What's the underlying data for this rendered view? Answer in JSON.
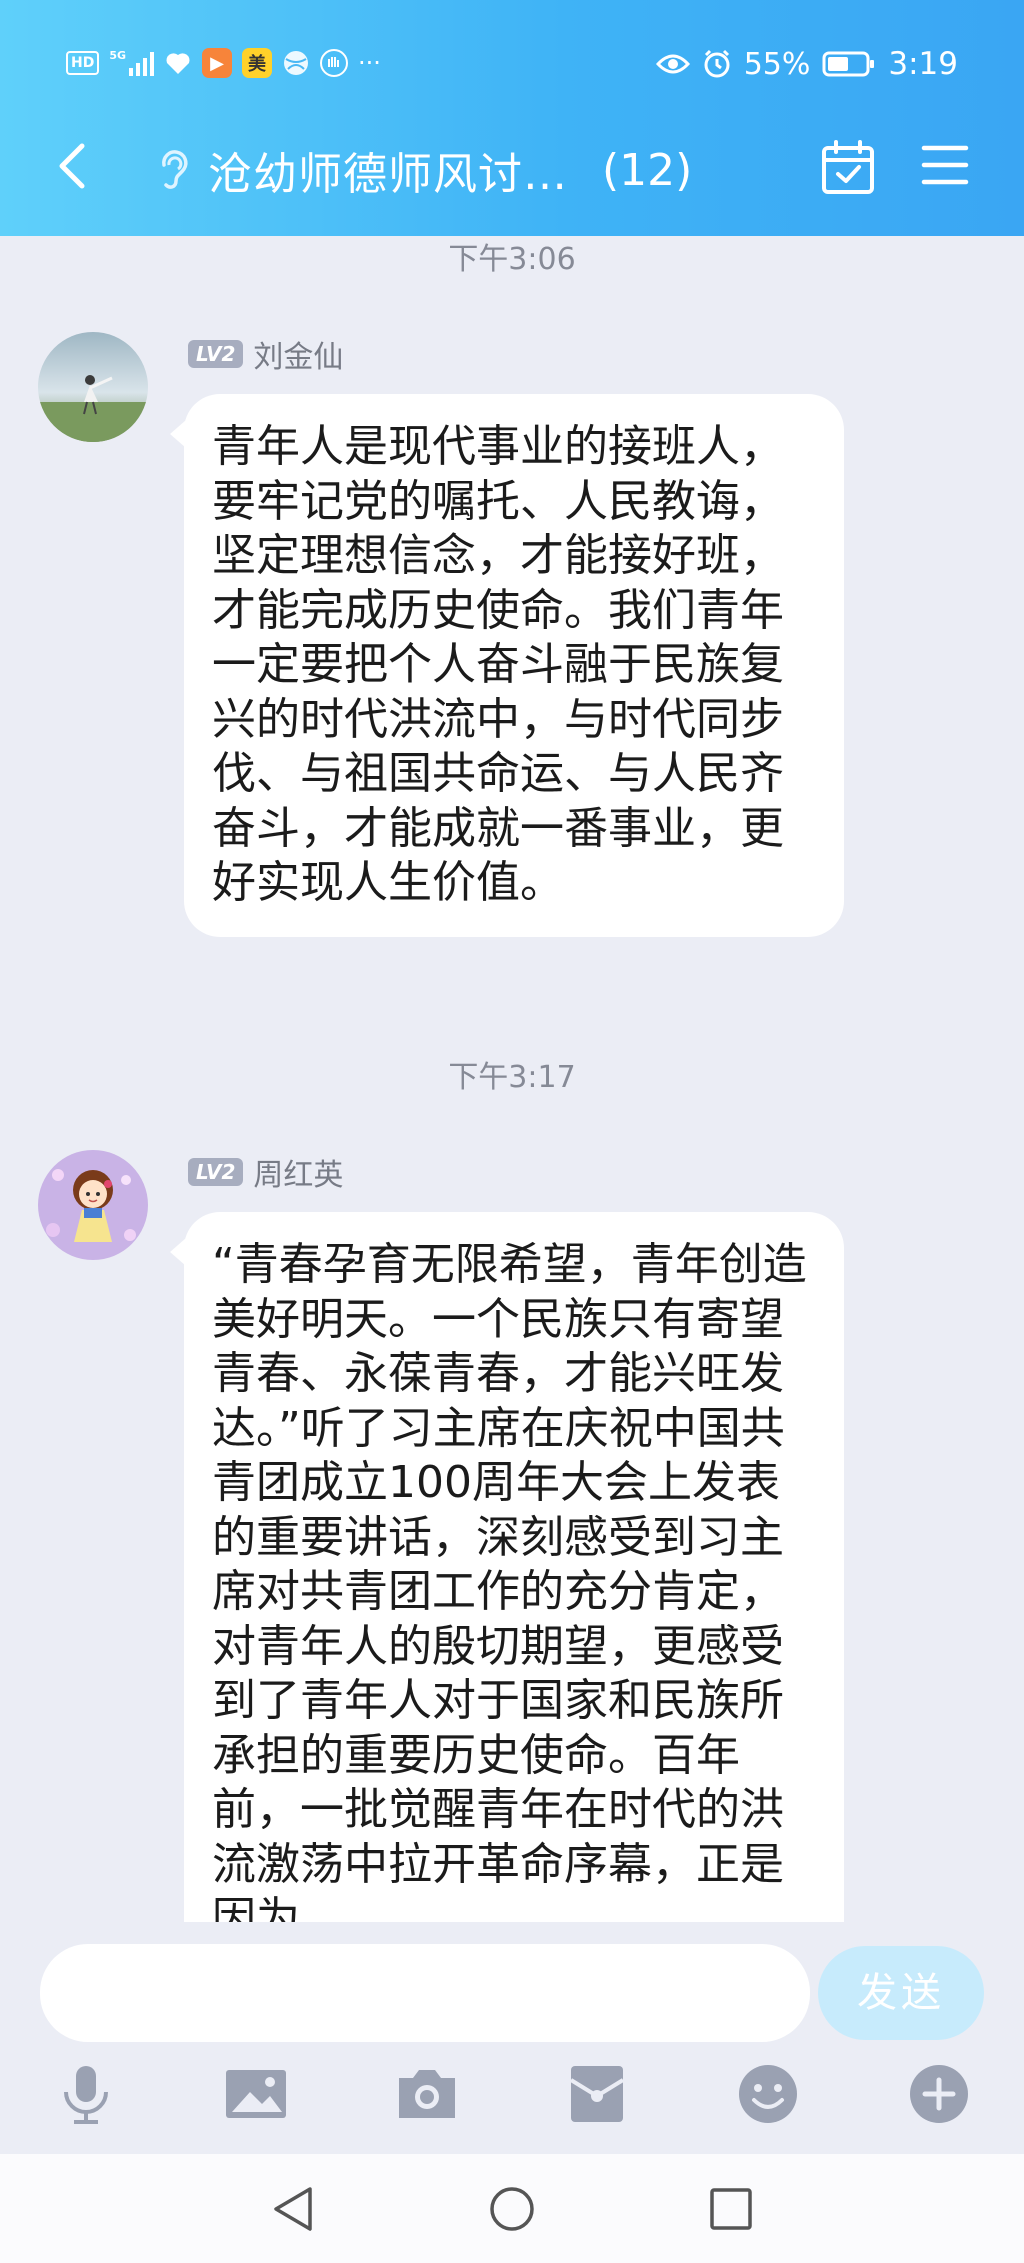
{
  "status_bar": {
    "left_badge": "HD",
    "network": "5G",
    "app_badge_mei": "美",
    "more_dots": "···",
    "battery": "55%",
    "time": "3:19"
  },
  "header": {
    "title": "沧幼师德师风讨…",
    "member_count": "(12)",
    "icons": [
      "back-arrow-icon",
      "ear-icon",
      "calendar-check-icon",
      "menu-icon"
    ]
  },
  "messages": [
    {
      "timestamp": "下午3:06",
      "level": "LV2",
      "sender": "刘金仙",
      "text": "青年人是现代事业的接班人，要牢记党的嘱托、人民教诲，坚定理想信念，才能接好班，才能完成历史使命。我们青年一定要把个人奋斗融于民族复兴的时代洪流中，与时代同步伐、与祖国共命运、与人民齐奋斗，才能成就一番事业，更好实现人生价值。"
    },
    {
      "timestamp": "下午3:17",
      "level": "LV2",
      "sender": "周红英",
      "text": "“青春孕育无限希望，青年创造美好明天。一个民族只有寄望青春、永葆青春，才能兴旺发达。”听了习主席在庆祝中国共青团成立100周年大会上发表的重要讲话，深刻感受到习主席对共青团工作的充分肯定，对青年人的殷切期望，更感受到了青年人对于国家和民族所承担的重要历史使命。百年前，一批觉醒青年在时代的洪流激荡中拉开革命序幕，正是因为"
    }
  ],
  "input_bar": {
    "send_label": "发送",
    "tools": [
      "microphone-icon",
      "image-icon",
      "camera-icon",
      "red-packet-icon",
      "emoji-icon",
      "plus-icon"
    ]
  },
  "colors": {
    "header_gradient_start": "#5fd0fa",
    "header_gradient_end": "#3aa6f3",
    "chat_background": "#ebedf5",
    "send_button": "#c7ebfc",
    "tool_icon": "#9aa1b2"
  }
}
